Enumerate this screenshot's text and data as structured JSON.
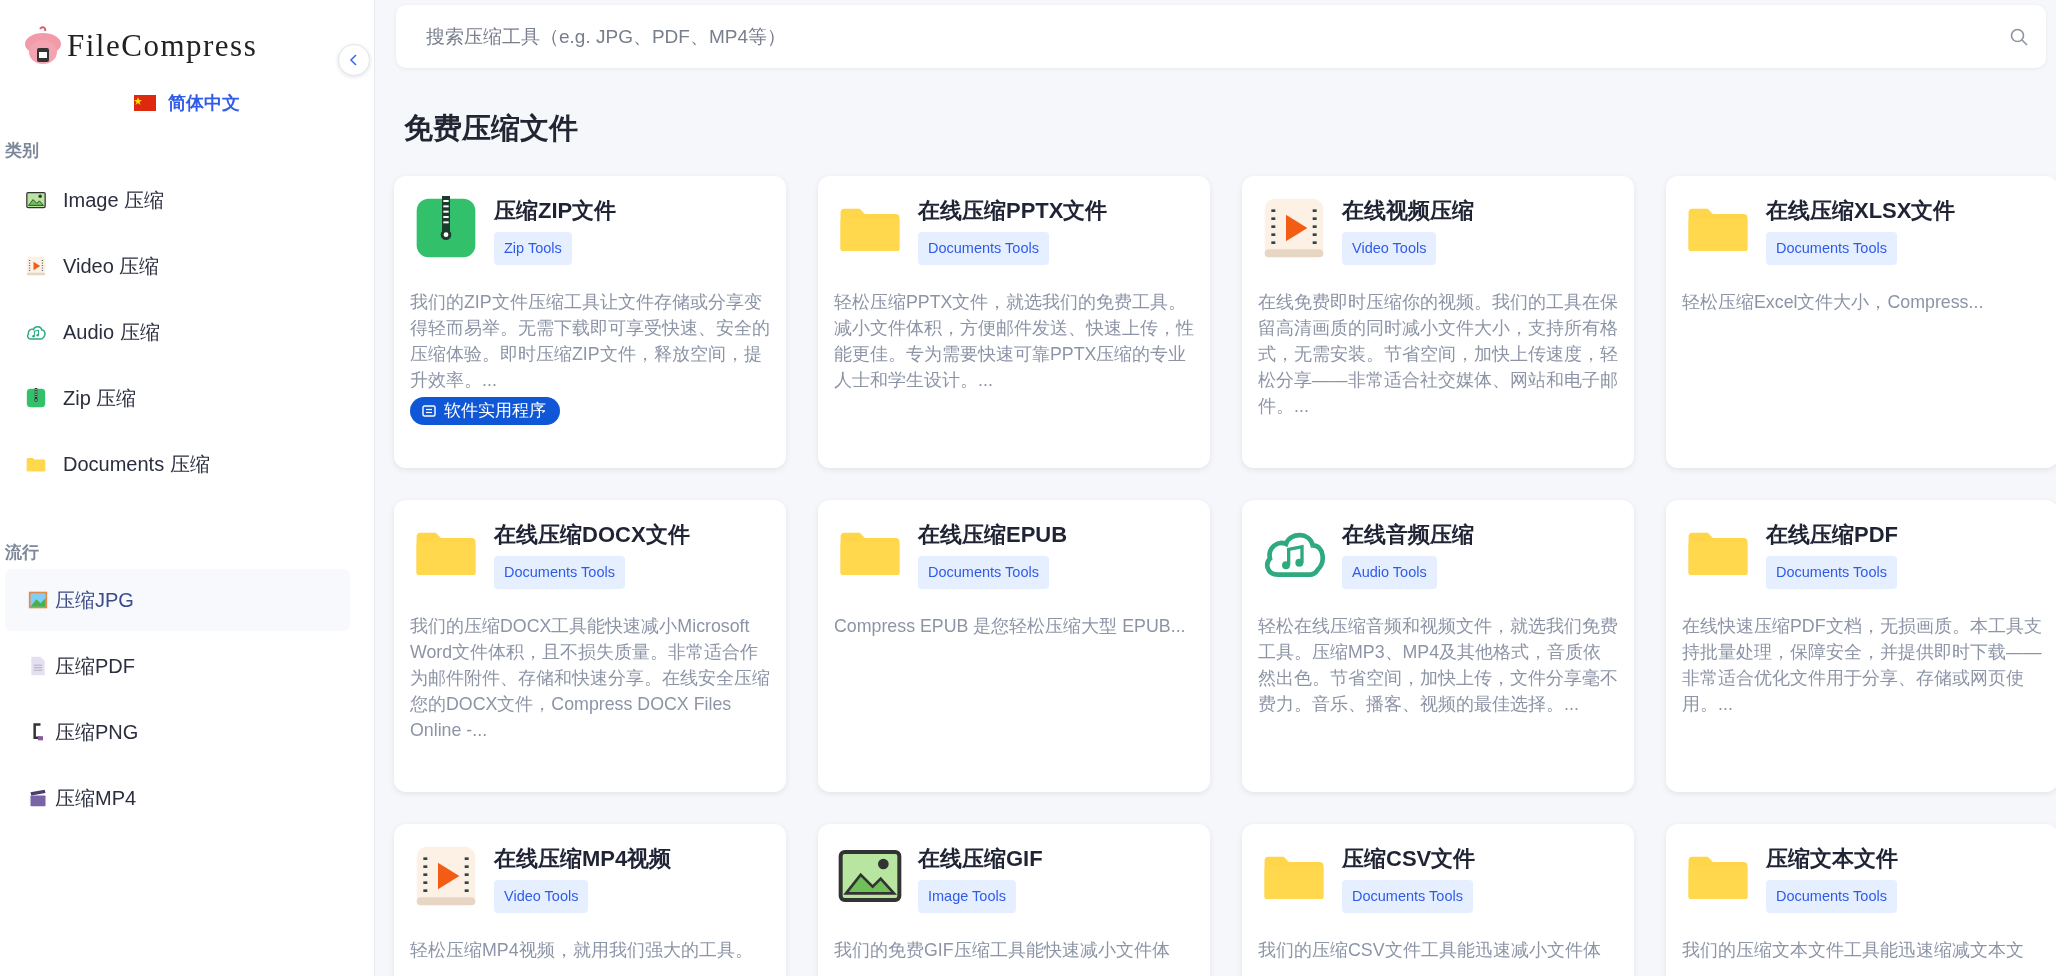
{
  "sidebar": {
    "logo": "FileCompress",
    "language": "简体中文",
    "categories_title": "类别",
    "categories": [
      {
        "label": "Image 压缩",
        "kind": "image"
      },
      {
        "label": "Video 压缩",
        "kind": "video"
      },
      {
        "label": "Audio 压缩",
        "kind": "audio"
      },
      {
        "label": "Zip 压缩",
        "kind": "zip"
      },
      {
        "label": "Documents 压缩",
        "kind": "documents"
      }
    ],
    "popular_title": "流行",
    "popular": [
      {
        "label": "压缩JPG",
        "kind": "jpg",
        "selected": true
      },
      {
        "label": "压缩PDF",
        "kind": "pdf",
        "selected": false
      },
      {
        "label": "压缩PNG",
        "kind": "png",
        "selected": false
      },
      {
        "label": "压缩MP4",
        "kind": "mp4",
        "selected": false
      }
    ]
  },
  "search": {
    "placeholder": "搜索压缩工具（e.g. JPG、PDF、MP4等）"
  },
  "heading": "免费压缩文件",
  "cards": [
    {
      "title": "压缩ZIP文件",
      "tag": "Zip Tools",
      "kind": "zip",
      "description": "我们的ZIP文件压缩工具让文件存储或分享变得轻而易举。无需下载即可享受快速、安全的压缩体验。即时压缩ZIP文件，释放空间，提升效率。...",
      "badge": "软件实用程序"
    },
    {
      "title": "在线压缩PPTX文件",
      "tag": "Documents Tools",
      "kind": "documents",
      "description": "轻松压缩PPTX文件，就选我们的免费工具。减小文件体积，方便邮件发送、快速上传，性能更佳。专为需要快速可靠PPTX压缩的专业人士和学生设计。..."
    },
    {
      "title": "在线视频压缩",
      "tag": "Video Tools",
      "kind": "video",
      "description": "在线免费即时压缩你的视频。我们的工具在保留高清画质的同时减小文件大小，支持所有格式，无需安装。节省空间，加快上传速度，轻松分享——非常适合社交媒体、网站和电子邮件。..."
    },
    {
      "title": "在线压缩XLSX文件",
      "tag": "Documents Tools",
      "kind": "documents",
      "description": "轻松压缩Excel文件大小，Compress..."
    },
    {
      "title": "在线压缩DOCX文件",
      "tag": "Documents Tools",
      "kind": "documents",
      "description": "我们的压缩DOCX工具能快速减小Microsoft Word文件体积，且不损失质量。非常适合作为邮件附件、存储和快速分享。在线安全压缩您的DOCX文件，Compress DOCX Files Online -..."
    },
    {
      "title": "在线压缩EPUB",
      "tag": "Documents Tools",
      "kind": "documents",
      "description": "Compress EPUB 是您轻松压缩大型 EPUB..."
    },
    {
      "title": "在线音频压缩",
      "tag": "Audio Tools",
      "kind": "audio",
      "description": "轻松在线压缩音频和视频文件，就选我们免费工具。压缩MP3、MP4及其他格式，音质依然出色。节省空间，加快上传，文件分享毫不费力。音乐、播客、视频的最佳选择。..."
    },
    {
      "title": "在线压缩PDF",
      "tag": "Documents Tools",
      "kind": "documents",
      "description": "在线快速压缩PDF文档，无损画质。本工具支持批量处理，保障安全，并提供即时下载——非常适合优化文件用于分享、存储或网页使用。..."
    },
    {
      "title": "在线压缩MP4视频",
      "tag": "Video Tools",
      "kind": "video",
      "description": "轻松压缩MP4视频，就用我们强大的工具。"
    },
    {
      "title": "在线压缩GIF",
      "tag": "Image Tools",
      "kind": "image",
      "description": "我们的免费GIF压缩工具能快速减小文件体"
    },
    {
      "title": "压缩CSV文件",
      "tag": "Documents Tools",
      "kind": "documents",
      "description": "我们的压缩CSV文件工具能迅速减小文件体"
    },
    {
      "title": "压缩文本文件",
      "tag": "Documents Tools",
      "kind": "documents",
      "description": "我们的压缩文本文件工具能迅速缩减文本文"
    }
  ]
}
